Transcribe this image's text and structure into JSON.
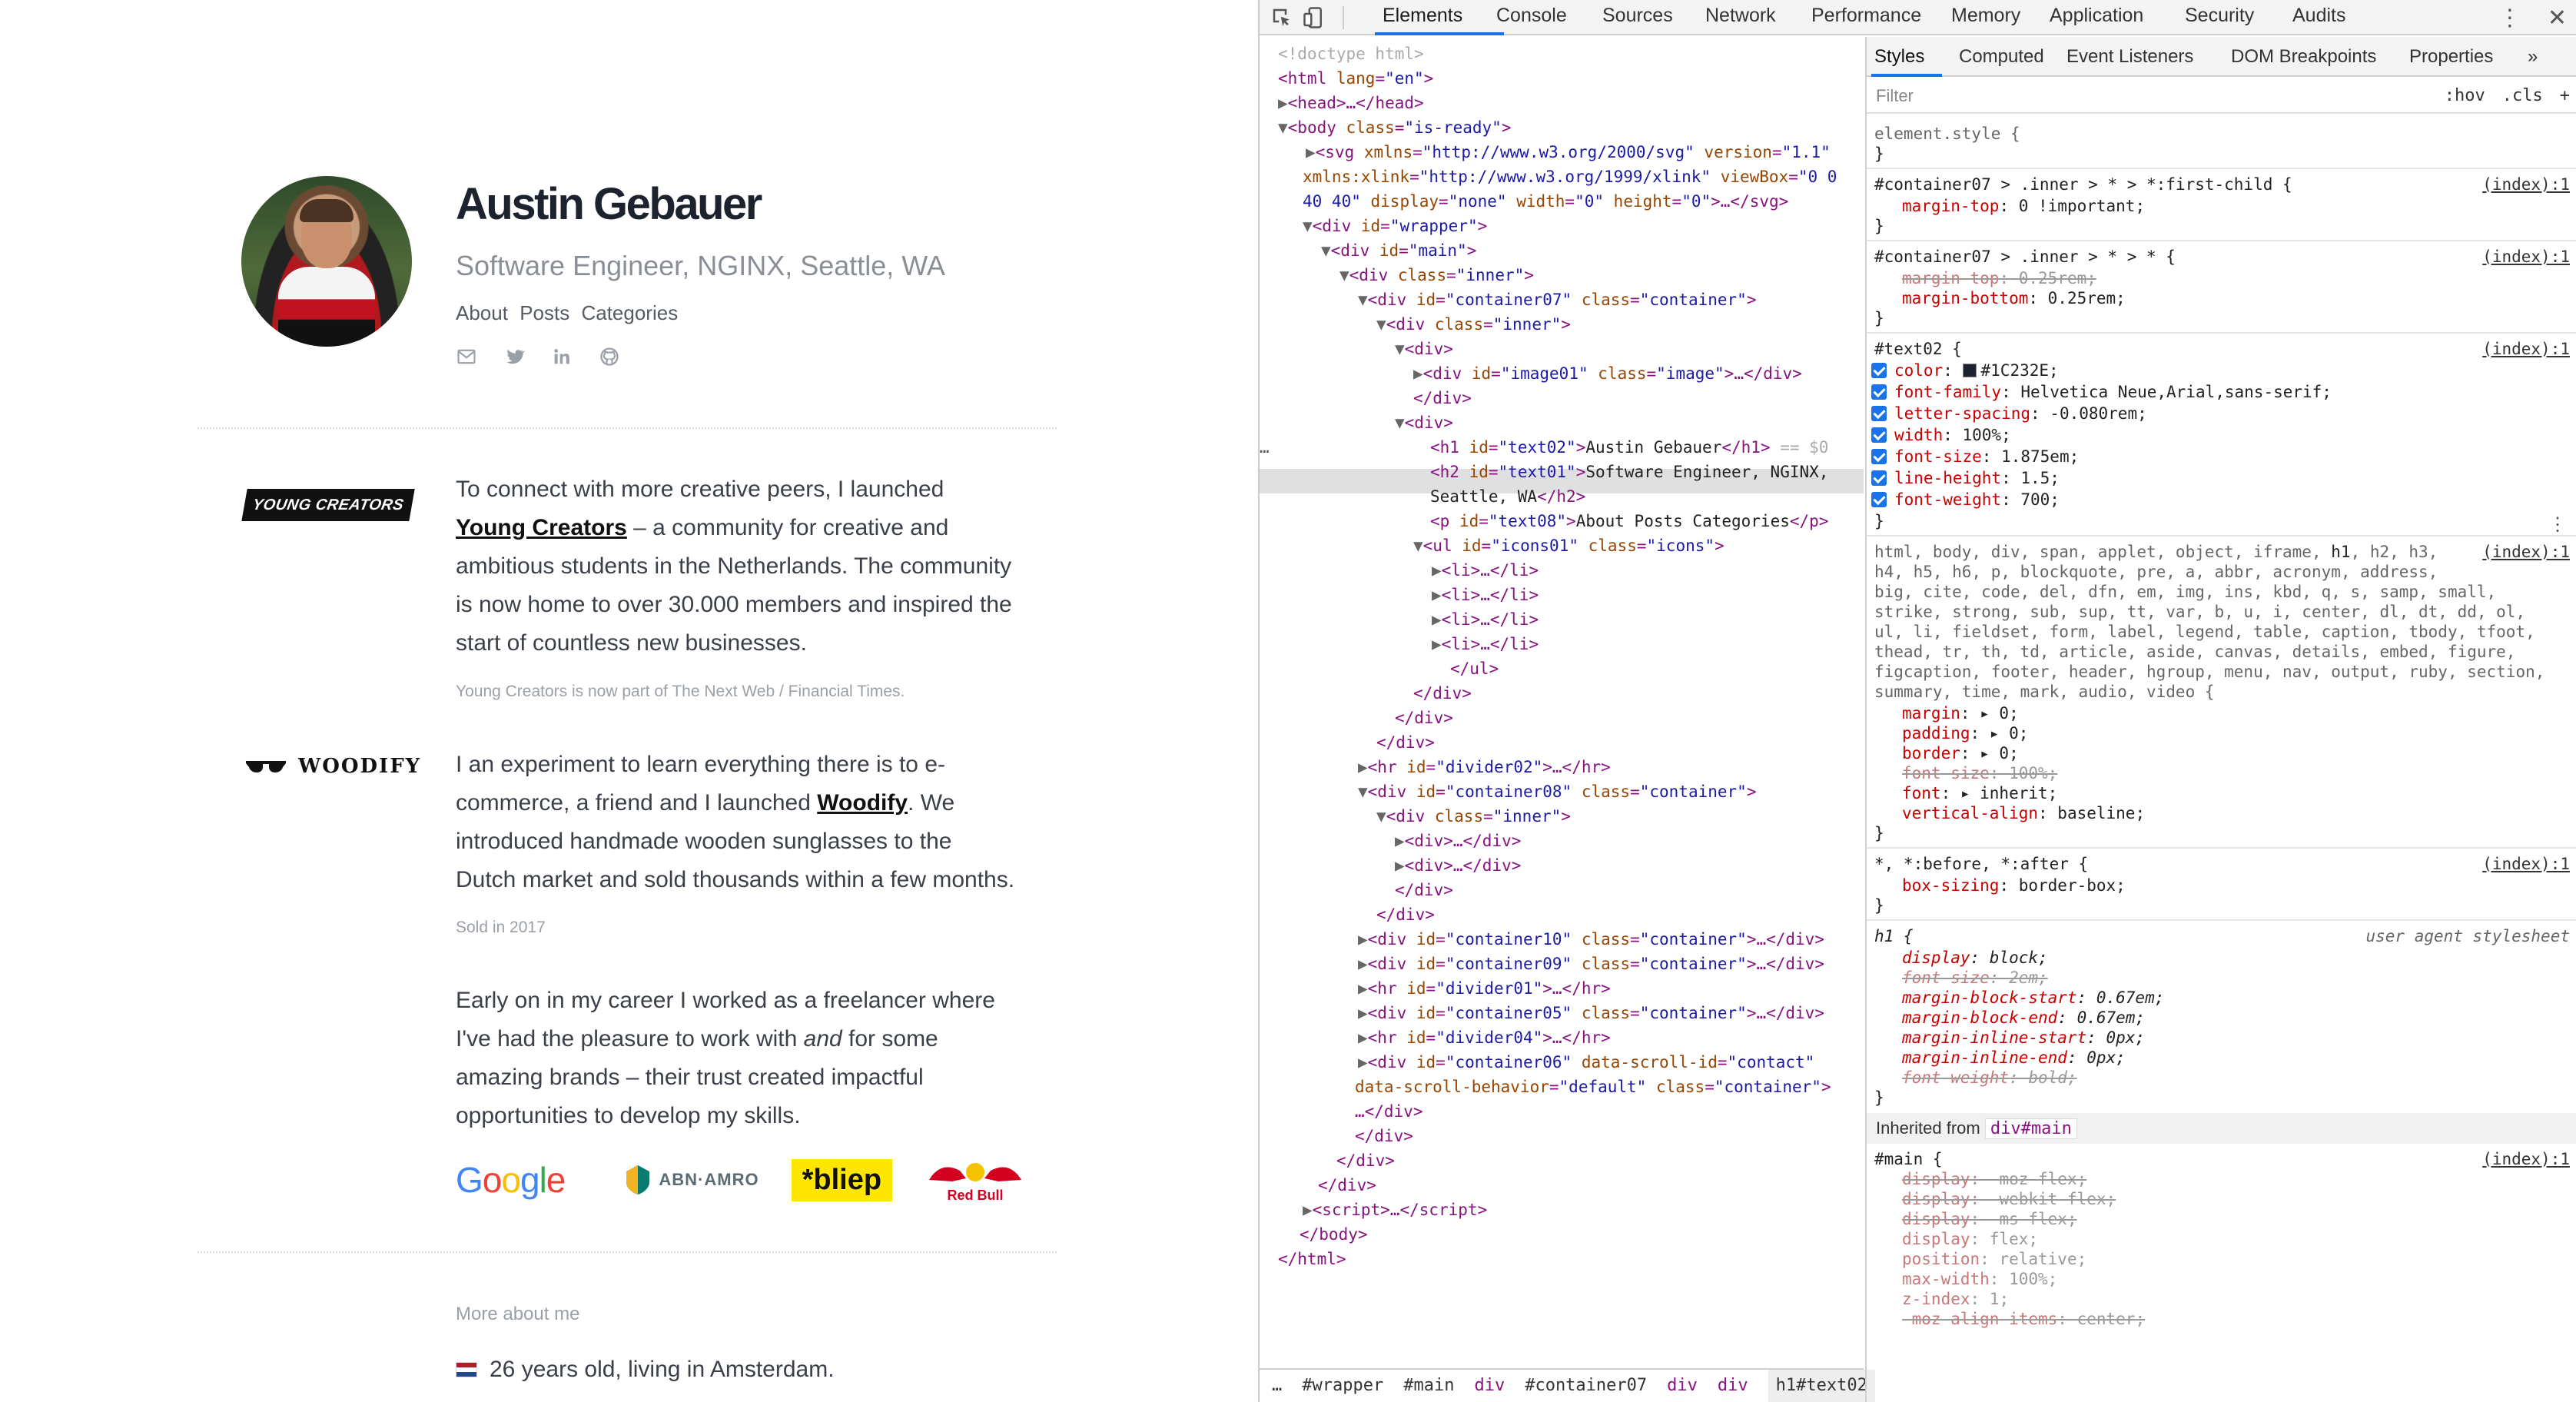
{
  "profile": {
    "name": "Austin Gebauer",
    "subtitle": "Software Engineer, NGINX, Seattle, WA",
    "nav": [
      "About",
      "Posts",
      "Categories"
    ],
    "social_icons": [
      "mail-icon",
      "twitter-icon",
      "linkedin-icon",
      "github-icon"
    ]
  },
  "sections": {
    "young_creators": {
      "logo_text": "YOUNG CREATORS",
      "text_before": "To connect with more creative peers, I launched ",
      "link": "Young Creators",
      "text_after": " – a community for creative and ambitious students in the Netherlands. The community is now home to over 30.000 members and inspired the start of countless new businesses.",
      "note": "Young Creators is now part of The Next Web / Financial Times."
    },
    "woodify": {
      "logo_text": "WOODIFY",
      "text_before": "I an experiment to learn everything there is to e-commerce, a friend and I launched ",
      "link": "Woodify",
      "text_after": ". We introduced handmade wooden sunglasses to the Dutch market and sold thousands within a few months.",
      "note": "Sold in 2017"
    },
    "freelance": {
      "text_before": "Early on in my career I worked as a freelancer where I've had the pleasure to work with ",
      "emph": "and",
      "text_after": " for some amazing brands – their trust created impactful opportunities to develop my skills.",
      "brands": [
        "Google",
        "ABN·AMRO",
        "*bliep",
        "Red Bull"
      ]
    },
    "more": {
      "title": "More about me",
      "item": "26 years old, living in Amsterdam."
    }
  },
  "devtools": {
    "tabs": [
      "Elements",
      "Console",
      "Sources",
      "Network",
      "Performance",
      "Memory",
      "Application",
      "Security",
      "Audits"
    ],
    "active_tab": "Elements",
    "styles_tabs": [
      "Styles",
      "Computed",
      "Event Listeners",
      "DOM Breakpoints",
      "Properties"
    ],
    "filter_placeholder": "Filter",
    "filter_hov": ":hov",
    "filter_cls": ".cls",
    "breadcrumb": [
      "#wrapper",
      "#main",
      "div",
      "#container07",
      "div",
      "div",
      "h1#text02"
    ],
    "inherited_label": "Inherited from",
    "inherited_from": "div#main",
    "ua_label": "user agent stylesheet",
    "source": "(index):1"
  },
  "colors": {
    "text": "#1C232E",
    "accent": "#1a73e8",
    "bliep": "#ffe600"
  }
}
